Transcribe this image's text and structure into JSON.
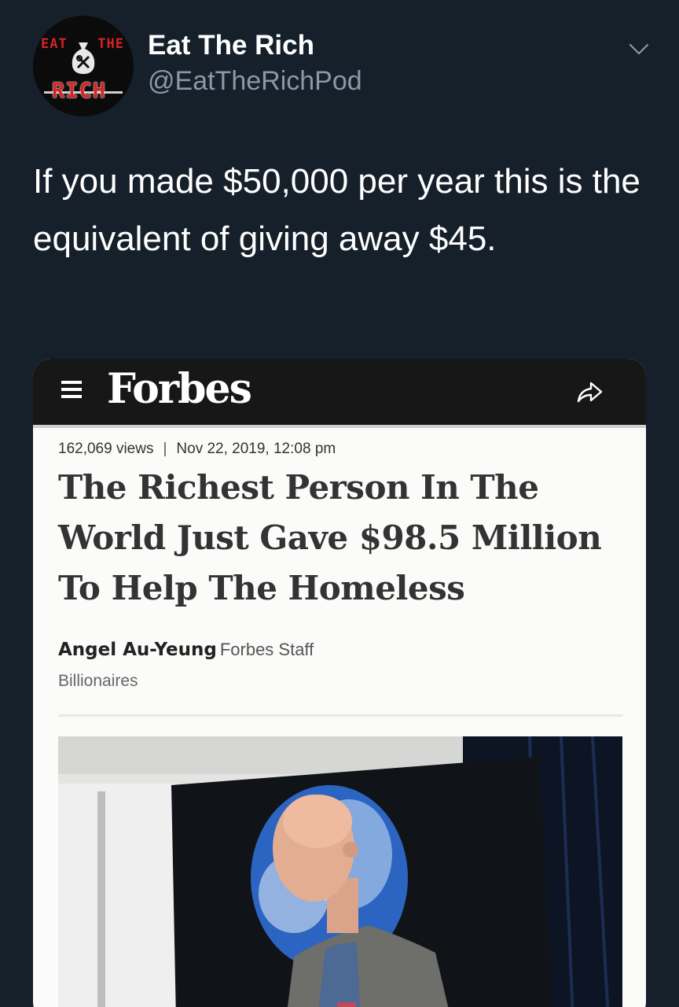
{
  "tweet": {
    "avatar": {
      "word1": "EAT",
      "word2": "THE",
      "word3": "RICH"
    },
    "display_name": "Eat The Rich",
    "handle": "@EatTheRichPod",
    "menu_icon": "chevron-down-icon",
    "text": "If you made $50,000 per year this is the equivalent of giving away $45."
  },
  "card": {
    "brand": "Forbes",
    "icons": [
      "menu-icon",
      "share-icon"
    ],
    "views": "162,069 views",
    "separator": "|",
    "date": "Nov 22, 2019, 12:08 pm",
    "headline": "The Richest Person In The World Just Gave $98.5 Million To Help The Homeless",
    "author": "Angel Au-Yeung",
    "author_role": "Forbes Staff",
    "section": "Billionaires"
  },
  "colors": {
    "background": "#15202b",
    "secondary_text": "#8899a6",
    "forbes_header": "#171717",
    "avatar_red": "#d62323"
  }
}
